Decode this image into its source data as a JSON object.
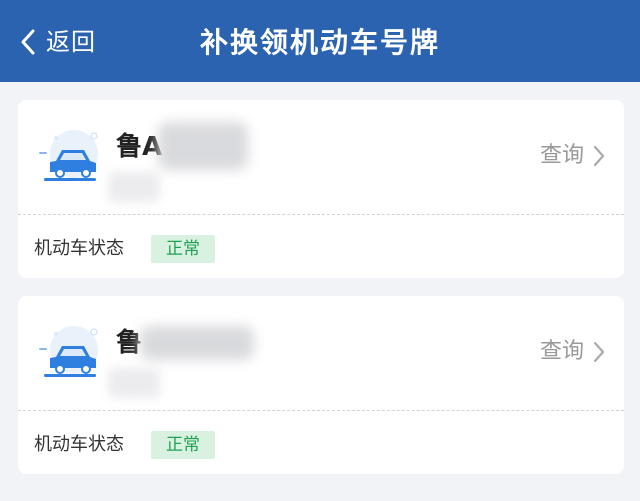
{
  "header": {
    "back_label": "返回",
    "title": "补换领机动车号牌",
    "background": "#2b63b1"
  },
  "vehicles": [
    {
      "plate": "鲁A",
      "query_label": "查询",
      "status_label": "机动车状态",
      "status": "正常"
    },
    {
      "plate": "鲁",
      "query_label": "查询",
      "status_label": "机动车状态",
      "status": "正常"
    }
  ],
  "colors": {
    "status_bg": "#d8f1e0",
    "status_text": "#21a152",
    "car_icon": "#2f7fe0"
  },
  "icons": {
    "back": "chevron-left-icon",
    "car": "car-icon",
    "arrow": "chevron-right-icon"
  }
}
